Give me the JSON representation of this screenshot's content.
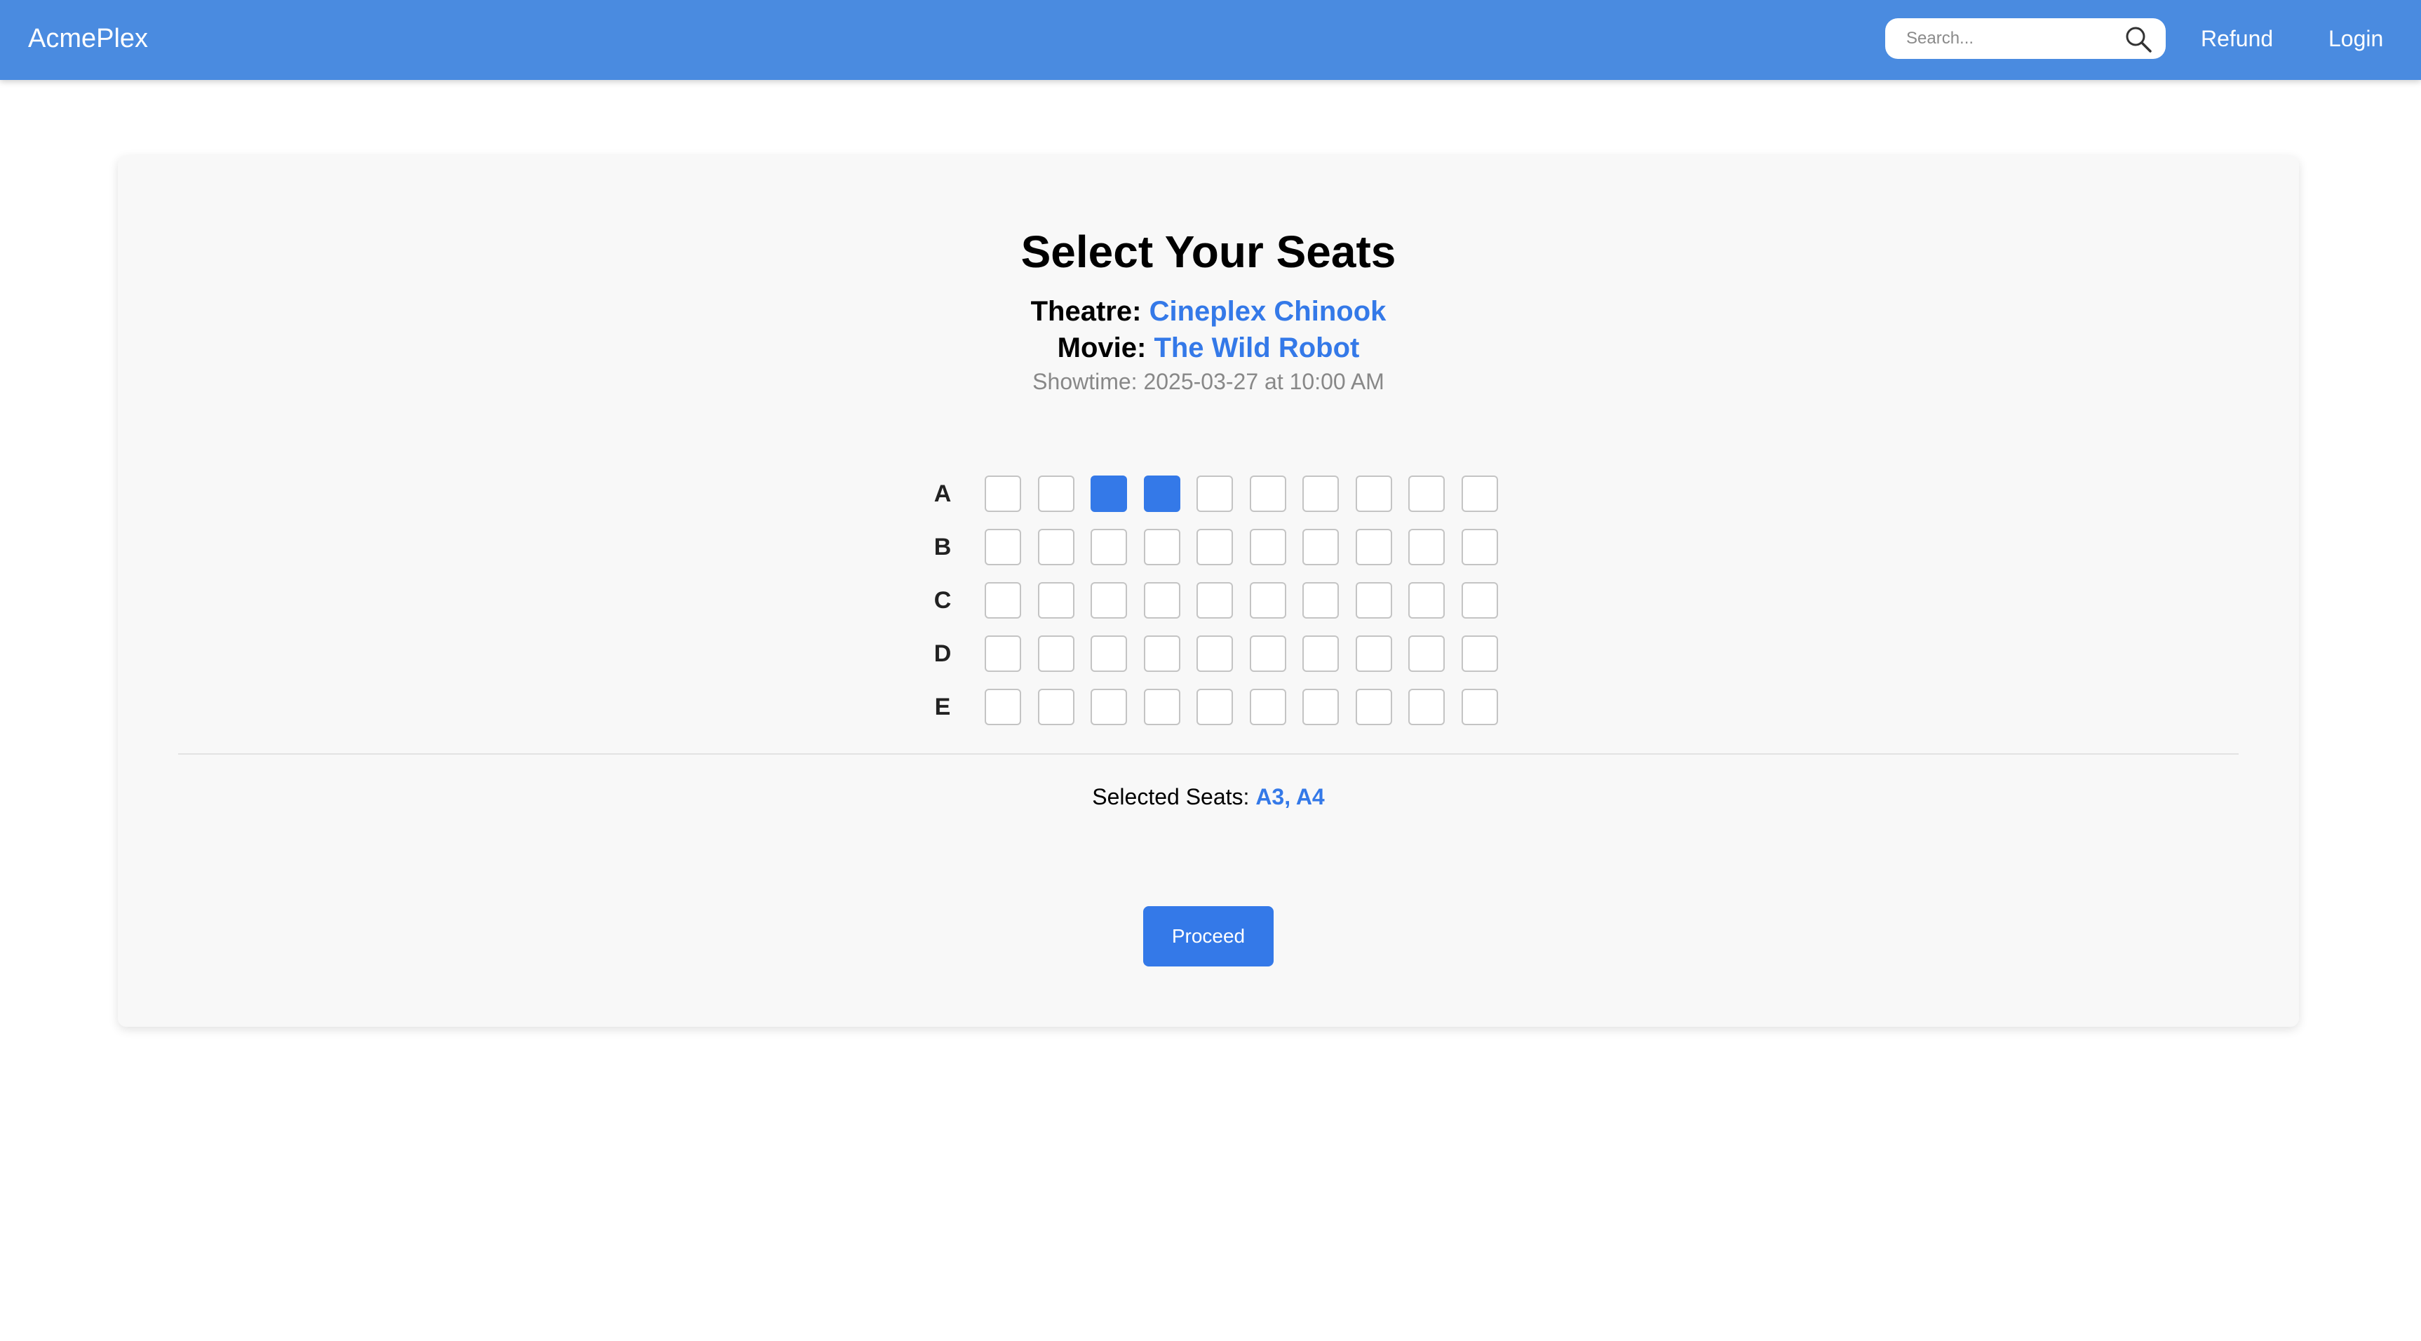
{
  "navbar": {
    "brand": "AcmePlex",
    "search_placeholder": "Search...",
    "search_icon": "search-icon",
    "refund_label": "Refund",
    "login_label": "Login",
    "background_color": "#4a8be0"
  },
  "page": {
    "title": "Select Your Seats",
    "theatre_label": "Theatre:",
    "theatre_value": "Cineplex Chinook",
    "movie_label": "Movie:",
    "movie_value": "The Wild Robot",
    "showtime": "Showtime: 2025-03-27 at 10:00 AM",
    "accent_color": "#3479e8"
  },
  "seating": {
    "rows": [
      "A",
      "B",
      "C",
      "D",
      "E"
    ],
    "seats_per_row": 10,
    "selected": [
      "A3",
      "A4"
    ]
  },
  "summary": {
    "label": "Selected Seats:",
    "value": "A3, A4"
  },
  "actions": {
    "proceed_label": "Proceed"
  }
}
